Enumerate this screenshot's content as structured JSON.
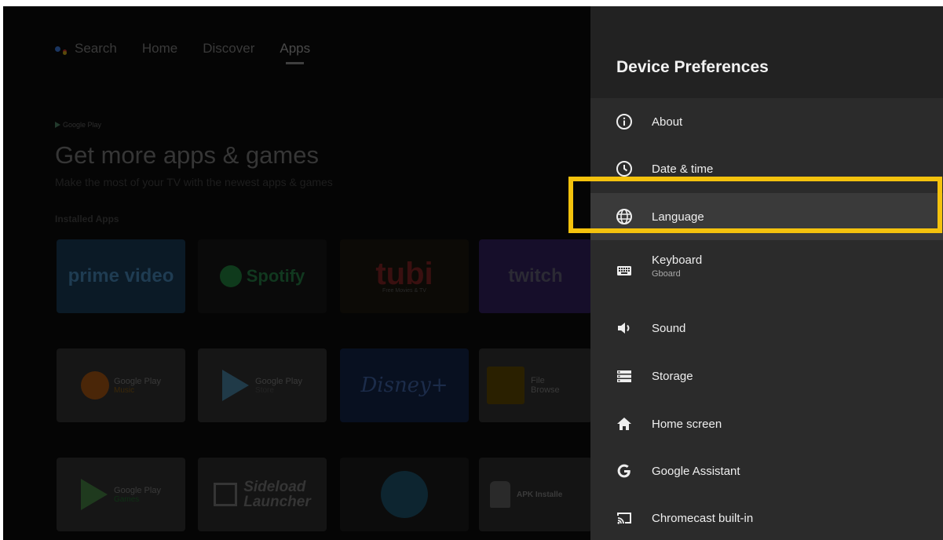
{
  "nav": {
    "items": [
      "Search",
      "Home",
      "Discover",
      "Apps"
    ],
    "active": "Apps"
  },
  "home": {
    "brand": "Google Play",
    "headline": "Get more apps & games",
    "subline": "Make the most of your TV with the newest apps & games",
    "section": "Installed Apps"
  },
  "apps": {
    "prime": "prime video",
    "spotify": "Spotify",
    "tubi": "tubi",
    "tubi_sub": "Free Movies & TV",
    "twitch": "twitch",
    "gpm_a": "Google Play",
    "gpm_b": "Music",
    "gps_a": "Google Play",
    "gps_b": "Store",
    "disney": "Disney+",
    "file_a": "File",
    "file_b": "Browse",
    "gpg_a": "Google Play",
    "gpg_b": "Games",
    "side_a": "Sideload",
    "side_b": "Launcher",
    "apk": "APK Installe"
  },
  "panel": {
    "title": "Device Preferences",
    "items": [
      {
        "label": "About",
        "icon": "info-icon"
      },
      {
        "label": "Date & time",
        "icon": "clock-icon"
      },
      {
        "label": "Language",
        "icon": "globe-icon"
      },
      {
        "label": "Keyboard",
        "sublabel": "Gboard",
        "icon": "keyboard-icon"
      },
      {
        "label": "Sound",
        "icon": "speaker-icon"
      },
      {
        "label": "Storage",
        "icon": "storage-icon"
      },
      {
        "label": "Home screen",
        "icon": "home-icon"
      },
      {
        "label": "Google Assistant",
        "icon": "google-g-icon"
      },
      {
        "label": "Chromecast built-in",
        "icon": "cast-icon"
      }
    ],
    "selected": "Language"
  },
  "colors": {
    "highlight": "#f4c20d",
    "panel_bg": "#2b2b2b",
    "header_bg": "#222222"
  }
}
